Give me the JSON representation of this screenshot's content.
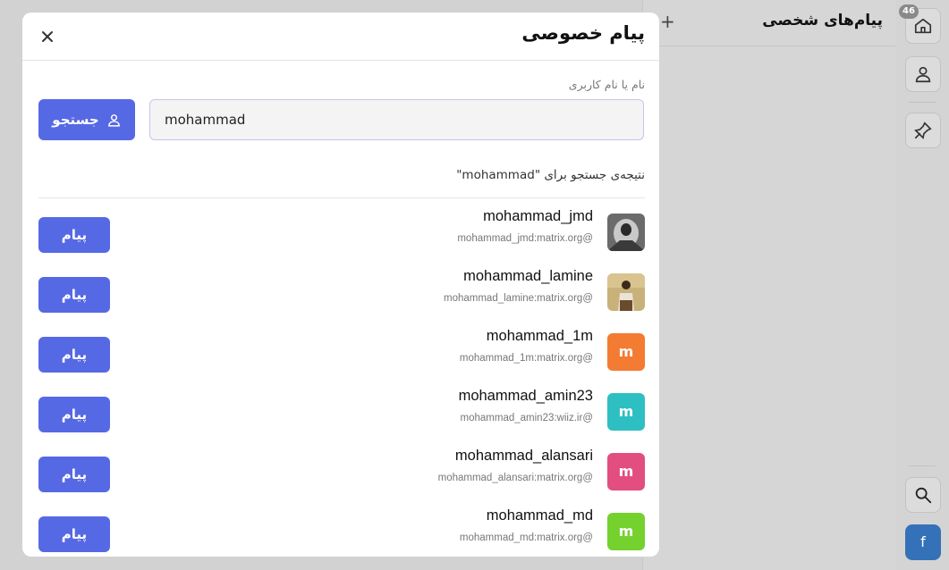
{
  "panel": {
    "title": "پیام‌های شخصی",
    "add_icon": "+"
  },
  "rail": {
    "badge": "46",
    "items": [
      {
        "name": "home-icon"
      },
      {
        "name": "user-icon"
      },
      {
        "name": "pin-icon"
      }
    ],
    "search_icon": "search-icon",
    "account_letter": "f"
  },
  "dialog": {
    "title": "پیام خصوصی",
    "close_label": "×",
    "field_label": "نام یا نام کاربری",
    "search_value": "mohammad",
    "search_button": "جستجو",
    "result_caption": "نتیجه‌ی جستجو برای \"mohammad\"",
    "message_button": "پیام",
    "results": [
      {
        "name": "mohammad_jmd",
        "id": "@mohammad_jmd:matrix.org",
        "avatar": "photo-bw",
        "color": "#555555"
      },
      {
        "name": "mohammad_lamine",
        "id": "@mohammad_lamine:matrix.org",
        "avatar": "photo-color",
        "color": "#8a6a3a"
      },
      {
        "name": "mohammad_1m",
        "id": "@mohammad_1m:matrix.org",
        "avatar": "m",
        "color": "#f37b32"
      },
      {
        "name": "mohammad_amin23",
        "id": "@mohammad_amin23:wiiz.ir",
        "avatar": "m",
        "color": "#2ebfc2"
      },
      {
        "name": "mohammad_alansari",
        "id": "@mohammad_alansari:matrix.org",
        "avatar": "m",
        "color": "#e24e7f"
      },
      {
        "name": "mohammad_md",
        "id": "@mohammad_md:matrix.org",
        "avatar": "m",
        "color": "#74d12e"
      }
    ]
  }
}
